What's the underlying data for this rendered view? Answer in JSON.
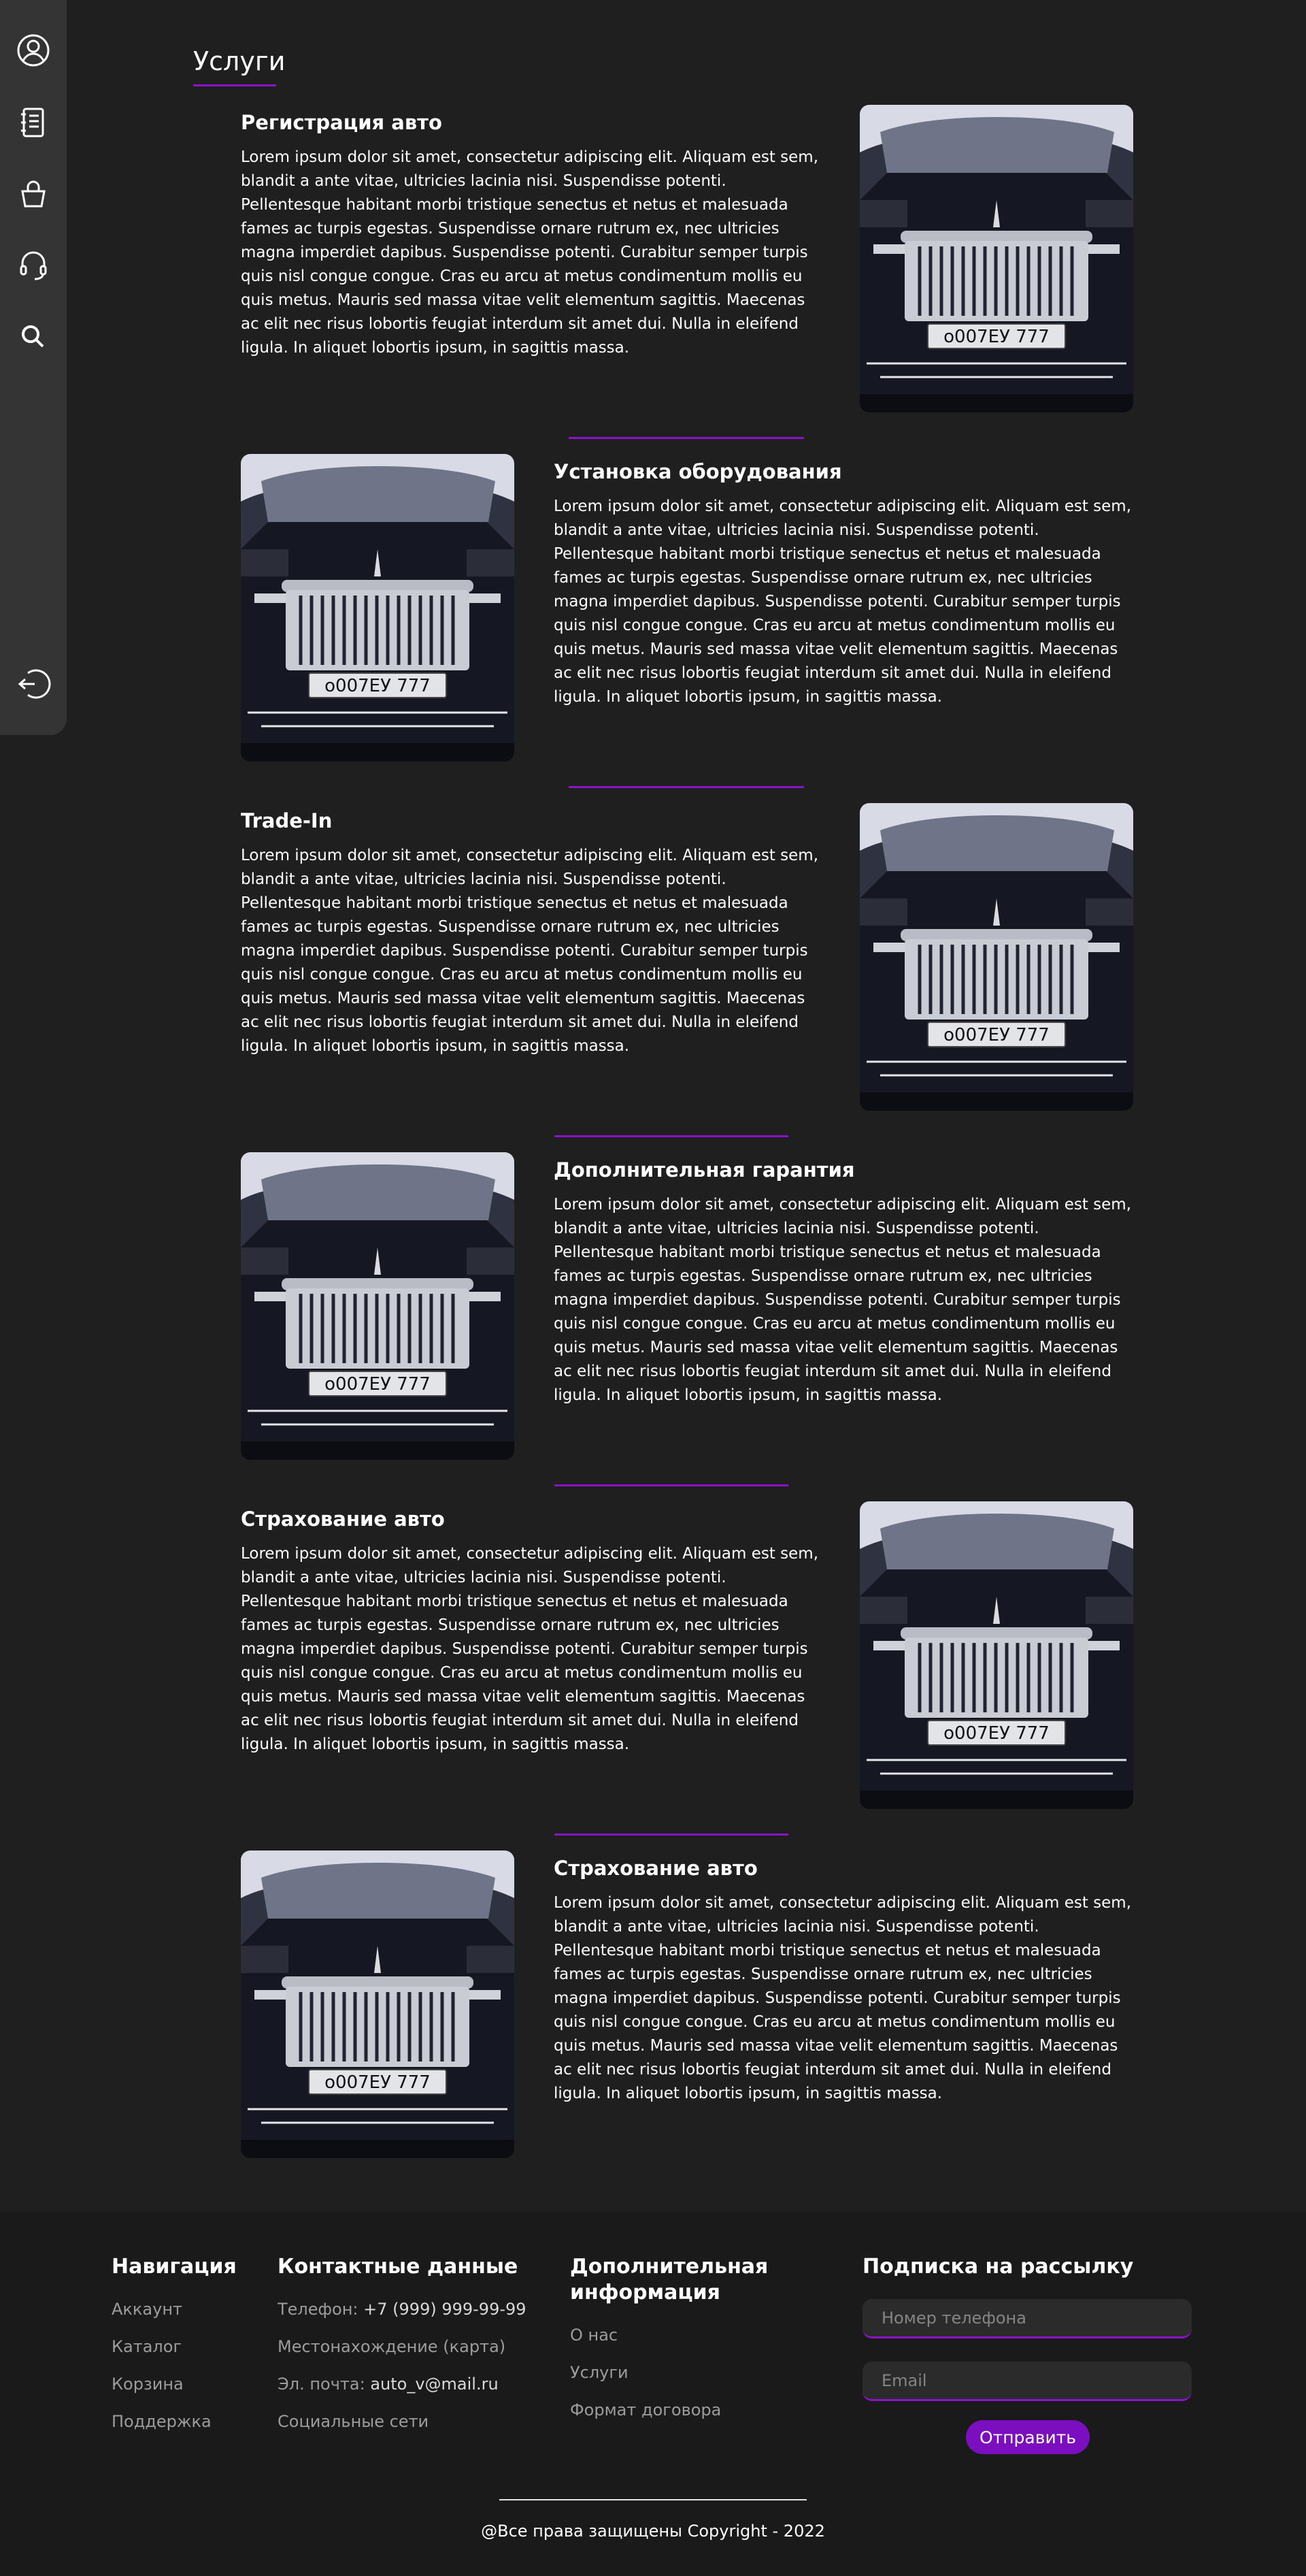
{
  "page": {
    "title": "Услуги"
  },
  "sidebar": {
    "icons": [
      "account-icon",
      "catalog-icon",
      "cart-icon",
      "support-icon",
      "search-icon",
      "logout-icon"
    ]
  },
  "services": [
    {
      "title": "Регистрация авто",
      "layout": "text-left"
    },
    {
      "title": "Установка оборудования",
      "layout": "text-right"
    },
    {
      "title": "Trade-In",
      "layout": "text-left"
    },
    {
      "title": "Дополнительная гарантия",
      "layout": "text-right"
    },
    {
      "title": "Страхование авто",
      "layout": "text-left"
    },
    {
      "title": "Страхование авто",
      "layout": "text-right"
    }
  ],
  "service_body": "Lorem ipsum dolor sit amet, consectetur adipiscing elit. Aliquam est sem, blandit a ante vitae, ultricies lacinia nisi. Suspendisse potenti. Pellentesque habitant morbi tristique senectus et netus et malesuada fames ac turpis egestas. Suspendisse ornare rutrum ex, nec ultricies magna imperdiet dapibus. Suspendisse potenti. Curabitur semper turpis quis nisl congue congue. Cras eu arcu at metus condimentum mollis eu quis metus. Mauris sed massa vitae velit elementum sagittis. Maecenas ac elit nec risus lobortis feugiat interdum sit amet dui. Nulla in eleifend ligula. In aliquet lobortis ipsum, in sagittis massa.",
  "car_plate": "о007ЕУ 777",
  "footer": {
    "nav": {
      "heading": "Навигация",
      "links": [
        "Аккаунт",
        "Каталог",
        "Корзина",
        "Поддержка"
      ]
    },
    "contacts": {
      "heading": "Контактные данные",
      "phone_label": "Телефон:",
      "phone_value": "+7 (999) 999-99-99",
      "location": "Местонахождение (карта)",
      "email_label": "Эл. почта:",
      "email_value": "auto_v@mail.ru",
      "social": "Социальные сети"
    },
    "extra": {
      "heading_line1": "Дополнительная",
      "heading_line2": "информация",
      "links": [
        "О нас",
        "Услуги",
        "Формат договора"
      ]
    },
    "subscribe": {
      "heading": "Подписка на рассылку",
      "phone_placeholder": "Номер телефона",
      "email_placeholder": "Email",
      "button": "Отправить"
    },
    "copyright": "@Все права защищены Copyright - 2022"
  },
  "colors": {
    "accent": "#8a12c9",
    "background": "#1f1f20",
    "sidebar": "#343435"
  }
}
